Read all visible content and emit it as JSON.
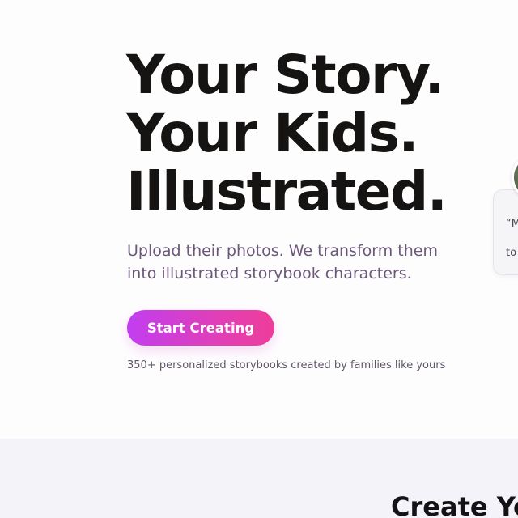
{
  "hero": {
    "headline_lines": [
      "Your Story.",
      "Your Kids.",
      "Illustrated."
    ],
    "subtitle_line1": "Upload their photos. We transform them",
    "subtitle_line2": "into illustrated storybook characters.",
    "cta_label": "Start Creating",
    "social_proof": "350+ personalized storybooks created by families like yours"
  },
  "testimonial": {
    "quote_line1": "“M",
    "quote_line2": "to"
  },
  "next_section": {
    "title": "Create Yo"
  },
  "colors": {
    "headline": "#161412",
    "subtitle": "#6b5779",
    "cta_gradient_start": "#c13ef0",
    "cta_gradient_end": "#ee3d9a",
    "section_bg": "#f4f3fa"
  }
}
